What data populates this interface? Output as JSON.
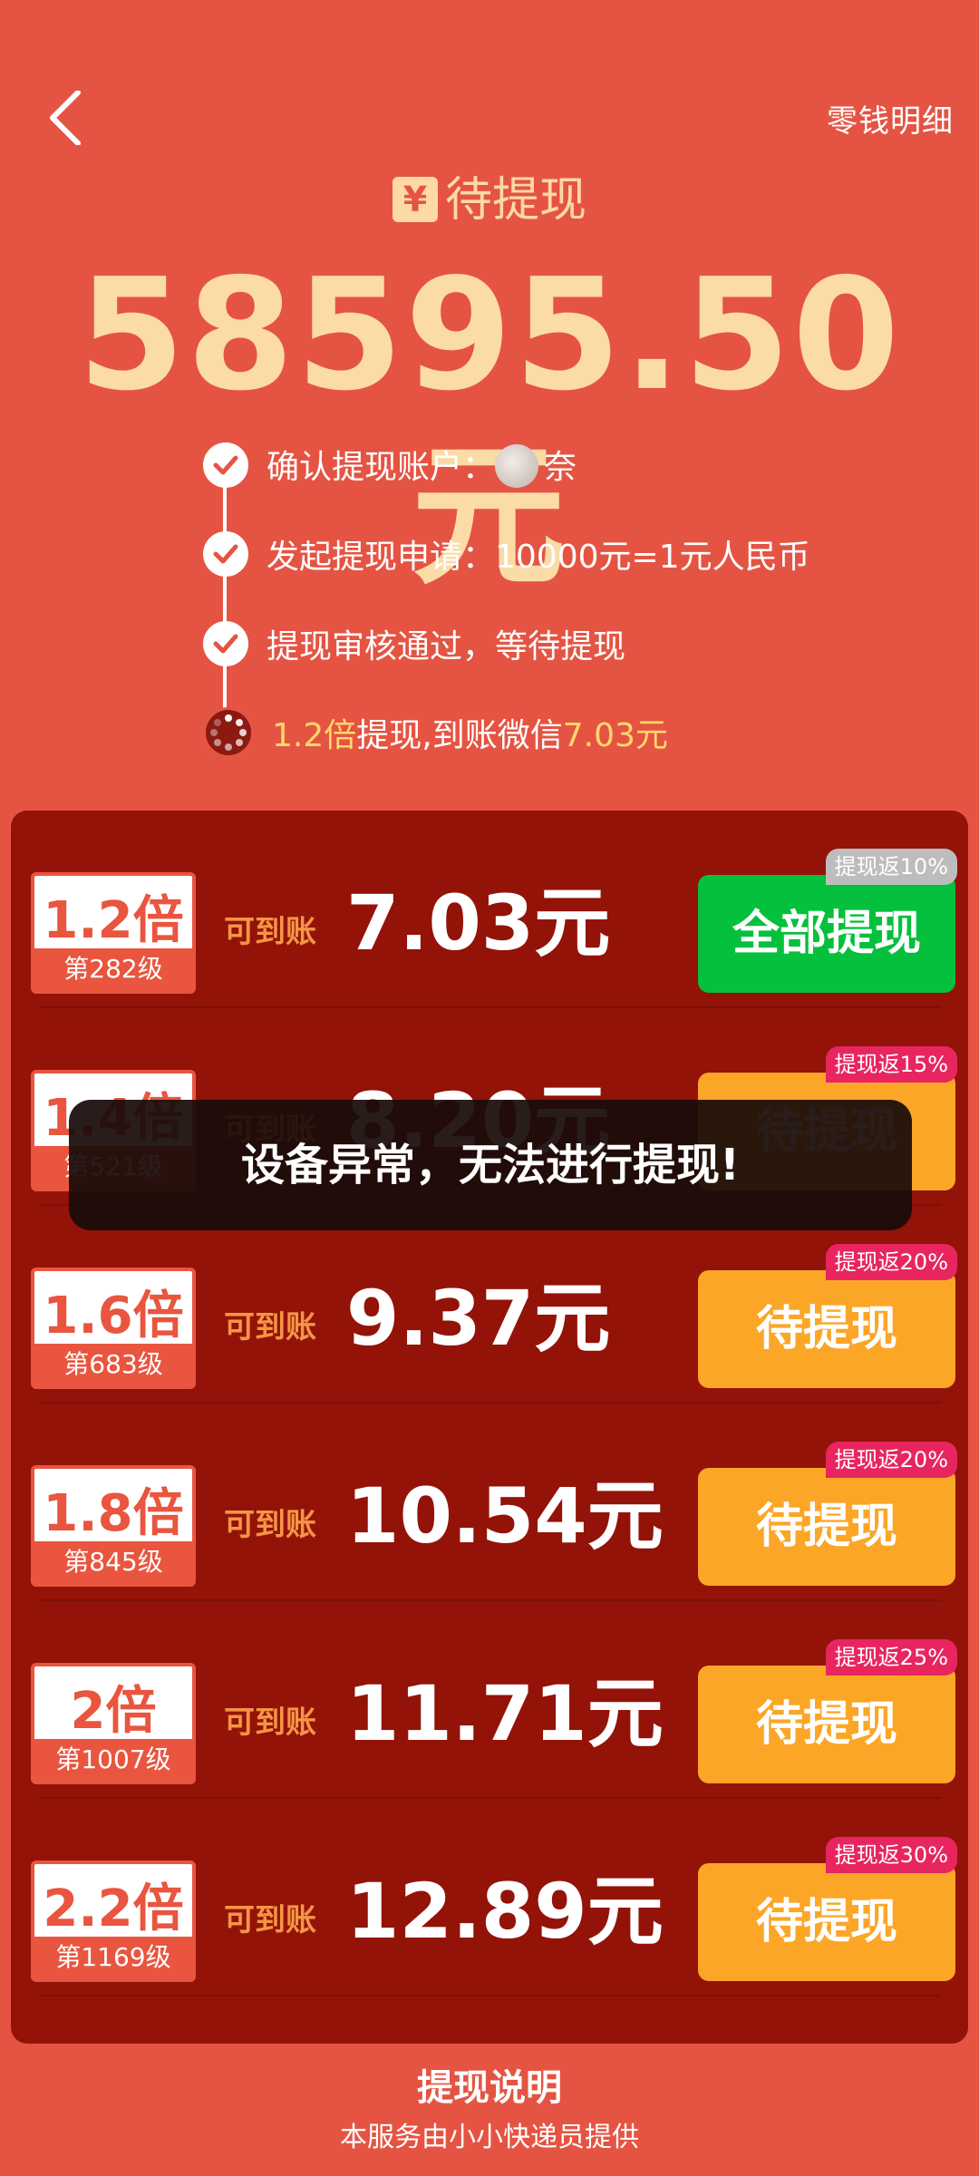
{
  "header": {
    "detail_link": "零钱明细",
    "pending_title": "待提现",
    "yen_icon": "¥"
  },
  "balance": "58595.50元",
  "steps": [
    {
      "label": "确认提现账户：",
      "account": "奈"
    },
    {
      "label": "发起提现申请：10000元=1元人民币"
    },
    {
      "label": "提现审核通过，等待提现"
    },
    {
      "mult": "1.2倍",
      "text": "提现,到账微信",
      "amount": "7.03元"
    }
  ],
  "receive_label": "可到账",
  "rows": [
    {
      "mult": "1.2倍",
      "level": "第282级",
      "amount": "7.03元",
      "button": "全部提现",
      "tag": "提现返10%",
      "button_color": "#05C03C"
    },
    {
      "mult": "1.4倍",
      "level": "第521级",
      "amount": "8.20元",
      "button": "待提现",
      "tag": "提现返15%",
      "button_color": "#FCA627"
    },
    {
      "mult": "1.6倍",
      "level": "第683级",
      "amount": "9.37元",
      "button": "待提现",
      "tag": "提现返20%",
      "button_color": "#FCA627"
    },
    {
      "mult": "1.8倍",
      "level": "第845级",
      "amount": "10.54元",
      "button": "待提现",
      "tag": "提现返20%",
      "button_color": "#FCA627"
    },
    {
      "mult": "2倍",
      "level": "第1007级",
      "amount": "11.71元",
      "button": "待提现",
      "tag": "提现返25%",
      "button_color": "#FCA627"
    },
    {
      "mult": "2.2倍",
      "level": "第1169级",
      "amount": "12.89元",
      "button": "待提现",
      "tag": "提现返30%",
      "button_color": "#FCA627"
    }
  ],
  "toast": "设备异常，无法进行提现!",
  "footer": {
    "title": "提现说明",
    "subtitle": "本服务由小小快递员提供"
  },
  "colors": {
    "background": "#E55443",
    "panel": "#931309",
    "gold": "#FBDBA6",
    "green": "#05C03C",
    "orange": "#FCA627",
    "tag_pink": "#E8255F"
  }
}
